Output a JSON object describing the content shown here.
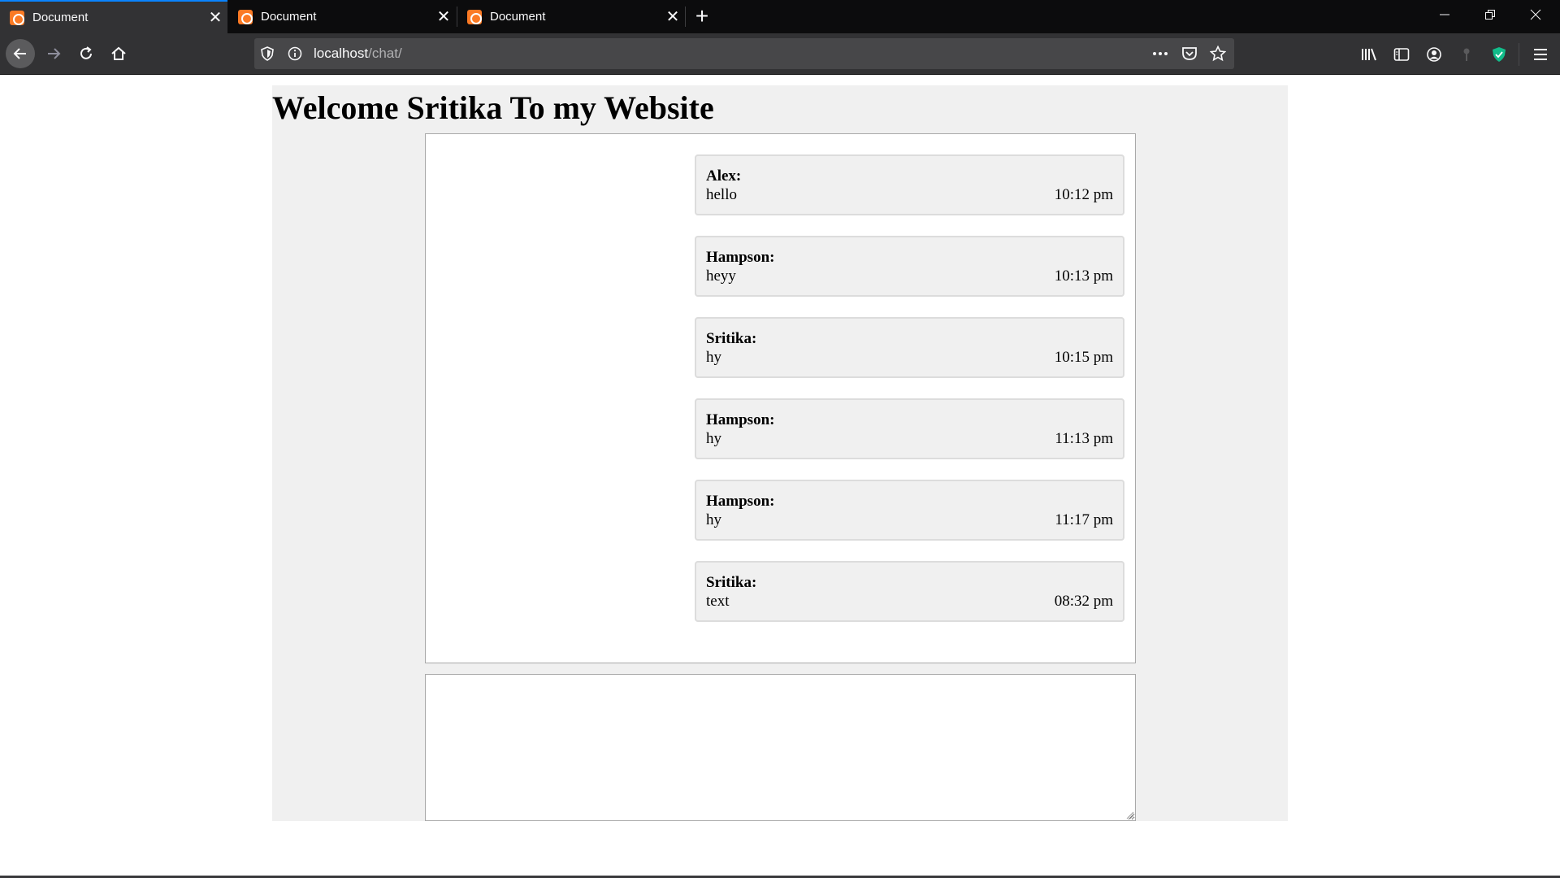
{
  "browser": {
    "tabs": [
      {
        "title": "Document",
        "active": true
      },
      {
        "title": "Document",
        "active": false
      },
      {
        "title": "Document",
        "active": false
      }
    ],
    "address": {
      "host": "localhost",
      "path": "/chat/"
    },
    "accent_color": "#0a84ff",
    "favicon_color": "#fb7a24",
    "icons": [
      "back-arrow-icon",
      "forward-arrow-icon",
      "reload-icon",
      "home-icon",
      "shield-icon",
      "info-icon",
      "more-icon",
      "pocket-icon",
      "star-icon",
      "library-icon",
      "sidebar-icon",
      "account-icon",
      "extension-icon",
      "shield-check-icon",
      "menu-icon"
    ]
  },
  "page": {
    "heading": "Welcome Sritika To my Website",
    "messages": [
      {
        "sender": "Alex:",
        "text": "hello",
        "time": "10:12 pm"
      },
      {
        "sender": "Hampson:",
        "text": "heyy",
        "time": "10:13 pm"
      },
      {
        "sender": "Sritika:",
        "text": "hy",
        "time": "10:15 pm"
      },
      {
        "sender": "Hampson:",
        "text": "hy",
        "time": "11:13 pm"
      },
      {
        "sender": "Hampson:",
        "text": "hy",
        "time": "11:17 pm"
      },
      {
        "sender": "Sritika:",
        "text": "text",
        "time": "08:32 pm"
      }
    ],
    "composer": {
      "value": ""
    }
  }
}
